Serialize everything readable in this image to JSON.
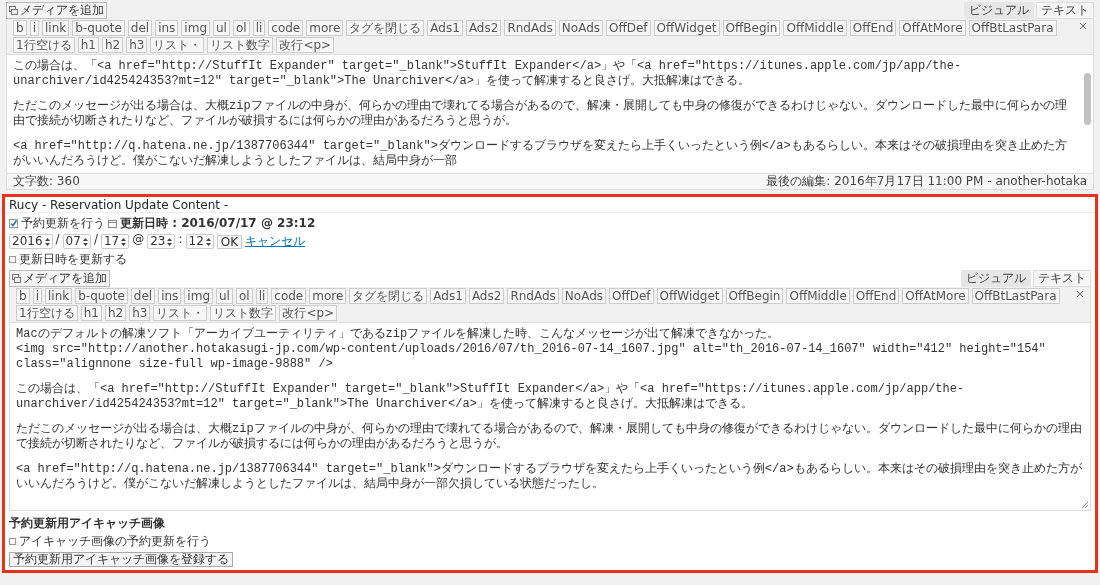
{
  "top_editor": {
    "media_button": "メディアを追加",
    "tabs": [
      {
        "label": "ビジュアル",
        "selected": false
      },
      {
        "label": "テキスト",
        "selected": true
      }
    ],
    "toolbar": [
      "b",
      "i",
      "link",
      "b-quote",
      "del",
      "ins",
      "img",
      "ul",
      "ol",
      "li",
      "code",
      "more",
      "タグを閉じる",
      "Ads1",
      "Ads2",
      "RndAds",
      "NoAds",
      "OffDef",
      "OffWidget",
      "OffBegin",
      "OffMiddle",
      "OffEnd",
      "OffAtMore",
      "OffBtLastPara",
      "1行空ける",
      "h1",
      "h2",
      "h3",
      "リスト・",
      "リスト数字",
      "改行<p>"
    ],
    "blocks": [
      {
        "lines": [
          "この場合は、「<a href=\"http://StuffIt Expander\" target=\"_blank\">StuffIt Expander</a>」や「<a href=\"https://itunes.apple.com/jp/app/the-unarchiver/id425424353?mt=12\" target=\"_blank\">The Unarchiver</a>」を使って解凍すると良さげ。大抵解凍はできる。"
        ]
      },
      {
        "lines": [
          "ただこのメッセージが出る場合は、大概zipファイルの中身が、何らかの理由で壊れてる場合があるので、解凍・展開しても中身の修復ができるわけじゃない。ダウンロードした最中に何らかの理由で接続が切断されたりなど、ファイルが破損するには何らかの理由があるだろうと思うが。"
        ]
      },
      {
        "lines": [
          "<a href=\"http://q.hatena.ne.jp/1387706344\" target=\"_blank\">ダウンロードするブラウザを変えたら上手くいったという例</a>もあるらしい。本来はその破損理由を突き止めた方がいいんだろうけど。僕がこないだ解凍しようとしたファイルは、結局中身が一部"
        ]
      }
    ],
    "word_count": "文字数: 360",
    "last_edit": "最後の編集: 2016年7月17日 11:00 PM - another-hotaka"
  },
  "rucy": {
    "title": "Rucy - Reservation Update Content -",
    "schedule": {
      "label": "予約更新を行う",
      "checked": true,
      "datetime": "更新日時 : 2016/07/17 @ 23:12"
    },
    "fields": [
      {
        "value": "2016",
        "sep": "/"
      },
      {
        "value": "07",
        "sep": "/"
      },
      {
        "value": "17",
        "sep": "@"
      },
      {
        "value": "23",
        "sep": ":"
      },
      {
        "value": "12"
      }
    ],
    "ok": "OK",
    "cancel": "キャンセル",
    "update_date": {
      "label": "更新日時を更新する",
      "checked": false
    },
    "editor": {
      "media_button": "メディアを追加",
      "tabs": [
        {
          "label": "ビジュアル",
          "selected": false
        },
        {
          "label": "テキスト",
          "selected": true
        }
      ],
      "toolbar": [
        "b",
        "i",
        "link",
        "b-quote",
        "del",
        "ins",
        "img",
        "ul",
        "ol",
        "li",
        "code",
        "more",
        "タグを閉じる",
        "Ads1",
        "Ads2",
        "RndAds",
        "NoAds",
        "OffDef",
        "OffWidget",
        "OffBegin",
        "OffMiddle",
        "OffEnd",
        "OffAtMore",
        "OffBtLastPara",
        "1行空ける",
        "h1",
        "h2",
        "h3",
        "リスト・",
        "リスト数字",
        "改行<p>"
      ],
      "blocks": [
        {
          "lines": [
            "Macのデフォルトの解凍ソフト「アーカイブユーティリティ」であるzipファイルを解凍した時、こんなメッセージが出て解凍できなかった。",
            "<img src=\"http://another.hotakasugi-jp.com/wp-content/uploads/2016/07/th_2016-07-14_1607.jpg\" alt=\"th_2016-07-14_1607\" width=\"412\" height=\"154\" class=\"alignnone size-full wp-image-9888\" />"
          ]
        },
        {
          "lines": [
            "この場合は、「<a href=\"http://StuffIt Expander\" target=\"_blank\">StuffIt Expander</a>」や「<a href=\"https://itunes.apple.com/jp/app/the-unarchiver/id425424353?mt=12\" target=\"_blank\">The Unarchiver</a>」を使って解凍すると良さげ。大抵解凍はできる。"
          ]
        },
        {
          "lines": [
            "ただこのメッセージが出る場合は、大概zipファイルの中身が、何らかの理由で壊れてる場合があるので、解凍・展開しても中身の修復ができるわけじゃない。ダウンロードした最中に何らかの理由で接続が切断されたりなど、ファイルが破損するには何らかの理由があるだろうと思うが。"
          ]
        },
        {
          "lines": [
            "<a href=\"http://q.hatena.ne.jp/1387706344\" target=\"_blank\">ダウンロードするブラウザを変えたら上手くいったという例</a>もあるらしい。本来はその破損理由を突き止めた方がいいんだろうけど。僕がこないだ解凍しようとしたファイルは、結局中身が一部欠損している状態だったし。"
          ]
        }
      ]
    },
    "eyecatch": {
      "heading": "予約更新用アイキャッチ画像",
      "option": {
        "label": "アイキャッチ画像の予約更新を行う",
        "checked": false
      },
      "button": "予約更新用アイキャッチ画像を登録する"
    }
  }
}
